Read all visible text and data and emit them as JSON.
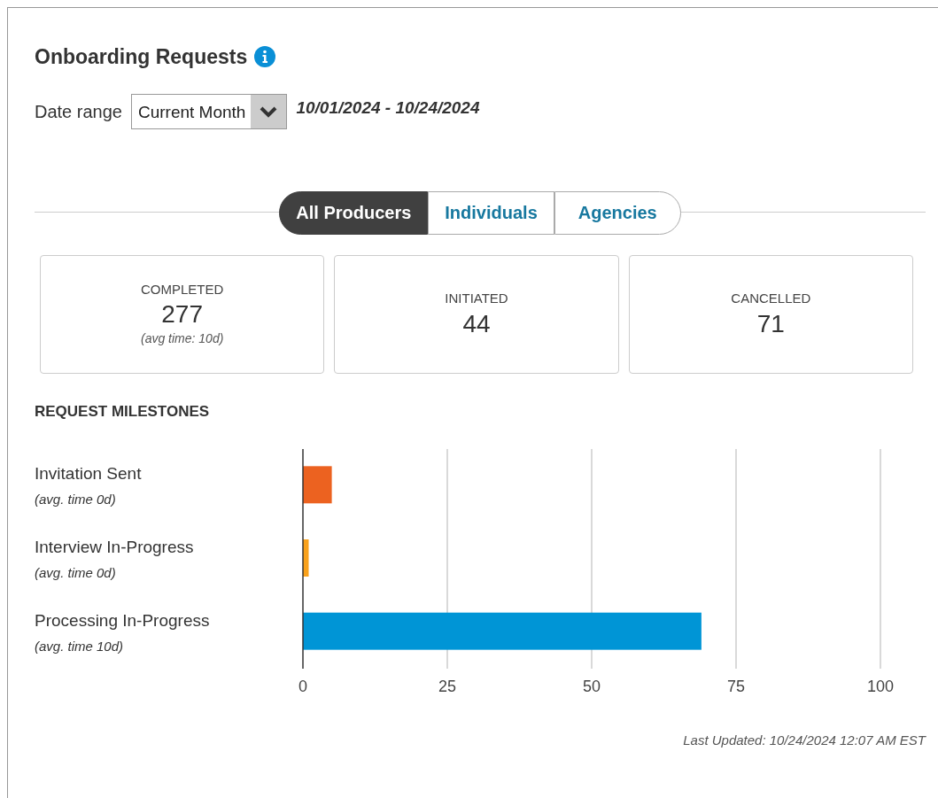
{
  "title": "Onboarding Requests",
  "date_range": {
    "label": "Date range",
    "value": "Current Month",
    "dates": "10/01/2024 - 10/24/2024"
  },
  "tabs": [
    {
      "label": "All Producers",
      "selected": true
    },
    {
      "label": "Individuals",
      "selected": false
    },
    {
      "label": "Agencies",
      "selected": false
    }
  ],
  "stats": [
    {
      "label": "COMPLETED",
      "value": "277",
      "note": "(avg time: 10d)"
    },
    {
      "label": "INITIATED",
      "value": "44"
    },
    {
      "label": "CANCELLED",
      "value": "71"
    }
  ],
  "milestones_title": "REQUEST MILESTONES",
  "milestone_notes": [
    "(avg. time 0d)",
    "(avg. time 0d)",
    "(avg. time 10d)"
  ],
  "chart_data": {
    "type": "bar",
    "orientation": "horizontal",
    "categories": [
      "Invitation Sent",
      "Interview In-Progress",
      "Processing In-Progress"
    ],
    "values": [
      5,
      1,
      69
    ],
    "grid": true,
    "colors": [
      "#ec6220",
      "#f9a11b",
      "#0095d6"
    ],
    "xlim": [
      0,
      100
    ],
    "xticks": [
      0,
      25,
      50,
      75,
      100
    ]
  },
  "last_updated": "Last Updated: 10/24/2024 12:07 AM EST"
}
